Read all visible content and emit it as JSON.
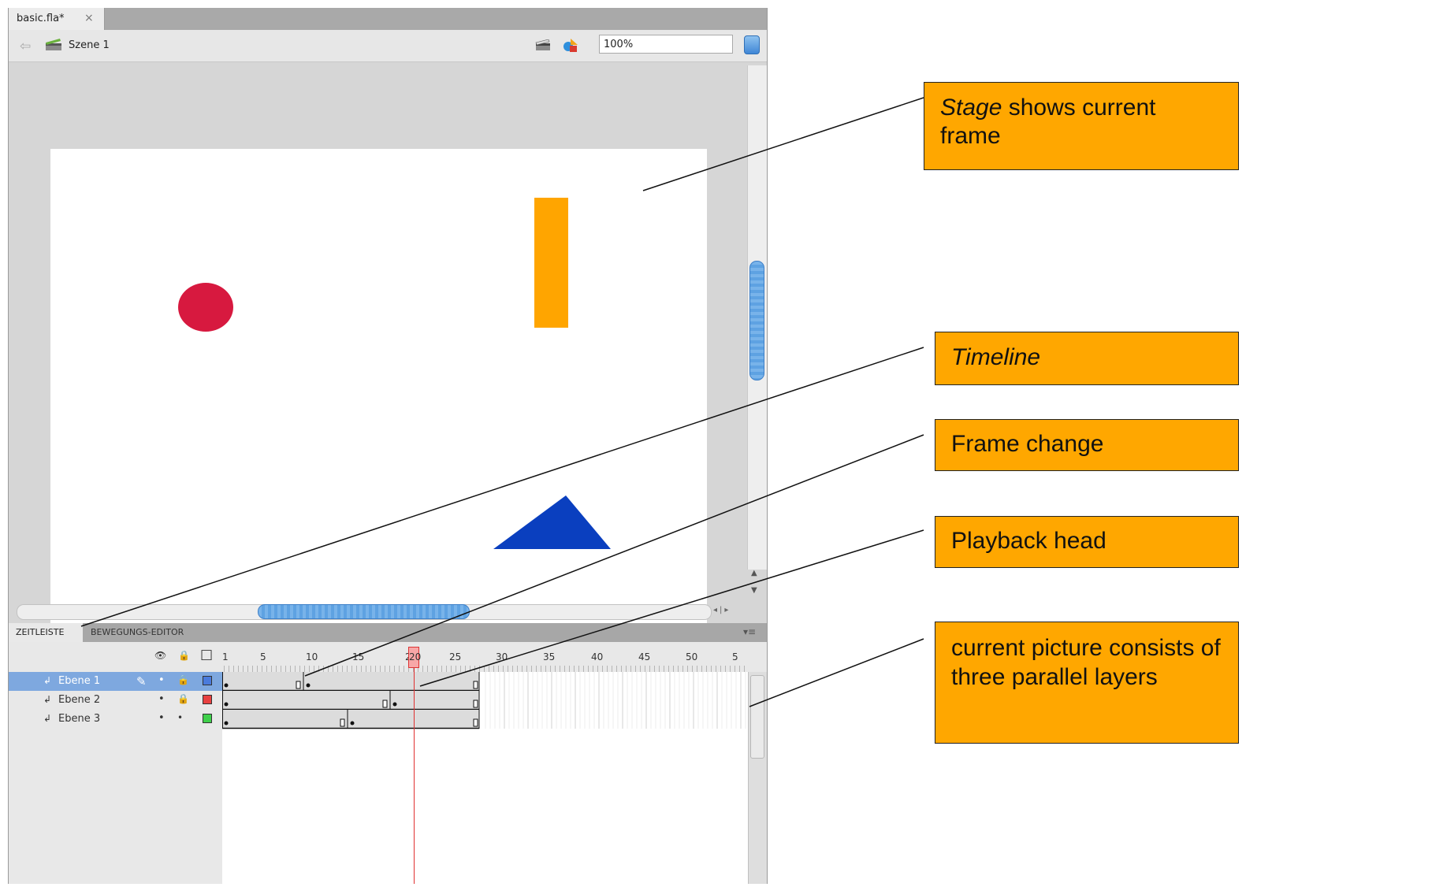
{
  "document_tab": {
    "title": "basic.fla*",
    "close": "×"
  },
  "toolbar": {
    "back": "⇦",
    "scene_label": "Szene 1",
    "zoom_value": "100%"
  },
  "stage": {
    "shapes": [
      {
        "kind": "circle",
        "color": "#d7193f"
      },
      {
        "kind": "rectangle",
        "color": "#ffa500"
      },
      {
        "kind": "triangle",
        "color": "#0a3fbf"
      }
    ]
  },
  "timeline_panel": {
    "tabs": [
      "ZEITLEISTE",
      "BEWEGUNGS-EDITOR"
    ],
    "menu_icon": "▾≡",
    "column_icons": {
      "eye": "👁",
      "lock": "🔒",
      "outline": "□"
    },
    "ruler": [
      "1",
      "5",
      "10",
      "15",
      "20",
      "25",
      "30",
      "35",
      "40",
      "45",
      "50",
      "5"
    ],
    "current_frame": "20",
    "layers": [
      {
        "name": "Ebene 1",
        "selected": true,
        "pencil": "✎",
        "visible": "•",
        "locked": "🔒",
        "outline_color": "#4a7bdc"
      },
      {
        "name": "Ebene 2",
        "selected": false,
        "visible": "•",
        "locked": "🔒",
        "outline_color": "#e84040"
      },
      {
        "name": "Ebene 3",
        "selected": false,
        "visible": "•",
        "locked": "•",
        "outline_color": "#3fd04b"
      }
    ]
  },
  "callouts": [
    {
      "em": "Stage",
      "text": " shows current frame"
    },
    {
      "em": "Timeline",
      "text": ""
    },
    {
      "em": "",
      "text": "Frame change"
    },
    {
      "em": "",
      "text": "Playback head"
    },
    {
      "em": "",
      "text": "current picture consists of three parallel layers"
    }
  ],
  "colors": {
    "callout_bg": "#ffa700",
    "selection": "#7ea8df",
    "playhead": "#e03030"
  }
}
